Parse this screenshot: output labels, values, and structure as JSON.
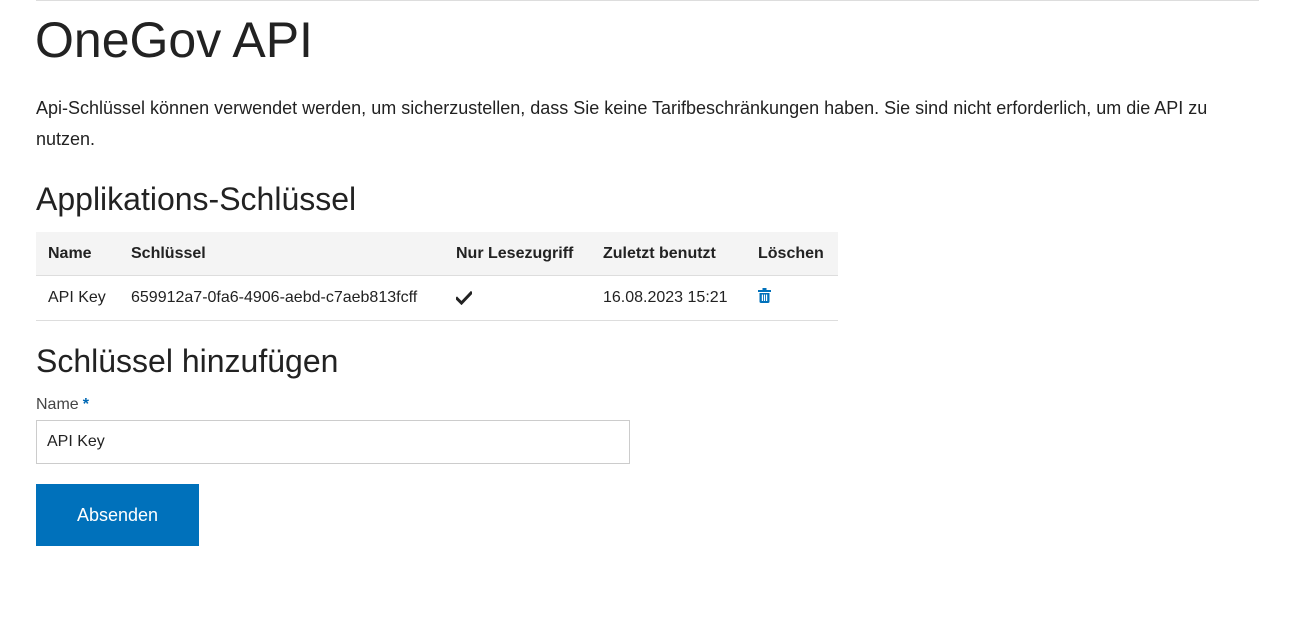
{
  "page": {
    "title": "OneGov API",
    "intro": "Api-Schlüssel können verwendet werden, um sicherzustellen, dass Sie keine Tarifbeschränkungen haben. Sie sind nicht erforderlich, um die API zu nutzen."
  },
  "keys_section": {
    "title": "Applikations-Schlüssel",
    "columns": {
      "name": "Name",
      "key": "Schlüssel",
      "read_only": "Nur Lesezugriff",
      "last_used": "Zuletzt benutzt",
      "delete": "Löschen"
    },
    "rows": [
      {
        "name": "API Key",
        "key": "659912a7-0fa6-4906-aebd-c7aeb813fcff",
        "read_only": true,
        "last_used": "16.08.2023 15:21"
      }
    ]
  },
  "add_section": {
    "title": "Schlüssel hinzufügen",
    "name_label": "Name",
    "required_mark": "*",
    "name_value": "API Key",
    "submit_label": "Absenden"
  },
  "icons": {
    "read_only": "check-icon",
    "delete": "trash-icon"
  },
  "colors": {
    "accent": "#0071bb",
    "header_bg": "#f4f4f4",
    "text": "#222222"
  }
}
